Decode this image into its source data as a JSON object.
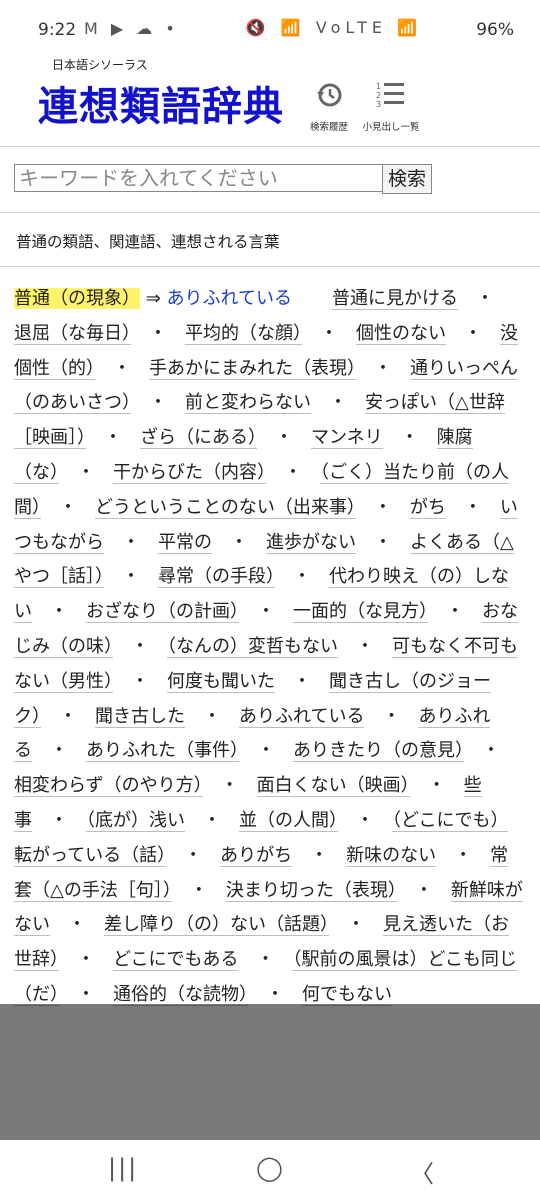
{
  "status": {
    "time": "9:22",
    "left_icons": "M ▶ ☁ •",
    "right_icons": "🔇 📶 VoLTE 📶",
    "battery": "96%"
  },
  "header": {
    "subtitle": "日本語シソーラス",
    "logo": "連想類語辞典",
    "history_icon": "history-icon",
    "history_label": "検索履歴",
    "index_icon": "list-numbered-icon",
    "index_label": "小見出し一覧"
  },
  "search": {
    "placeholder": "キーワードを入れてください",
    "button_label": "検索"
  },
  "heading": "普通の類語、関連語、連想される言葉",
  "results": {
    "lead": "普通（の現象）",
    "arrow": "⇒",
    "link": "ありふれている",
    "terms": [
      "普通に見かける",
      "退屈（な毎日）",
      "平均的（な顔）",
      "個性のない",
      "没個性（的）",
      "手あかにまみれた（表現）",
      "通りいっぺん（のあいさつ）",
      "前と変わらない",
      "安っぽい（△世辞［映画］）",
      "ざら（にある）",
      "マンネリ",
      "陳腐（な）",
      "干からびた（内容）",
      "（ごく）当たり前（の人間）",
      "どうということのない（出来事）",
      "がち",
      "いつもながら",
      "平常の",
      "進歩がない",
      "よくある（△やつ［話］）",
      "尋常（の手段）",
      "代わり映え（の）しない",
      "おざなり（の計画）",
      "一面的（な見方）",
      "おなじみ（の味）",
      "（なんの）変哲もない",
      "可もなく不可もない（男性）",
      "何度も聞いた",
      "聞き古し（のジョーク）",
      "聞き古した",
      "ありふれている",
      "ありふれる",
      "ありふれた（事件）",
      "ありきたり（の意見）",
      "相変わらず（のやり方）",
      "面白くない（映画）",
      "些事",
      "（底が）浅い",
      "並（の人間）",
      "（どこにでも）転がっている（話）",
      "ありがち",
      "新味のない",
      "常套（△の手法［句］）",
      "決まり切った（表現）",
      "新鮮味がない",
      "差し障り（の）ない（話題）",
      "見え透いた（お世辞）",
      "どこにでもある",
      "（駅前の風景は）どこも同じ（だ）",
      "通俗的（な読物）",
      "何でもない"
    ]
  },
  "navbar": {
    "recents_glyph": "|||",
    "home_glyph": "◯",
    "back_glyph": "〈"
  }
}
